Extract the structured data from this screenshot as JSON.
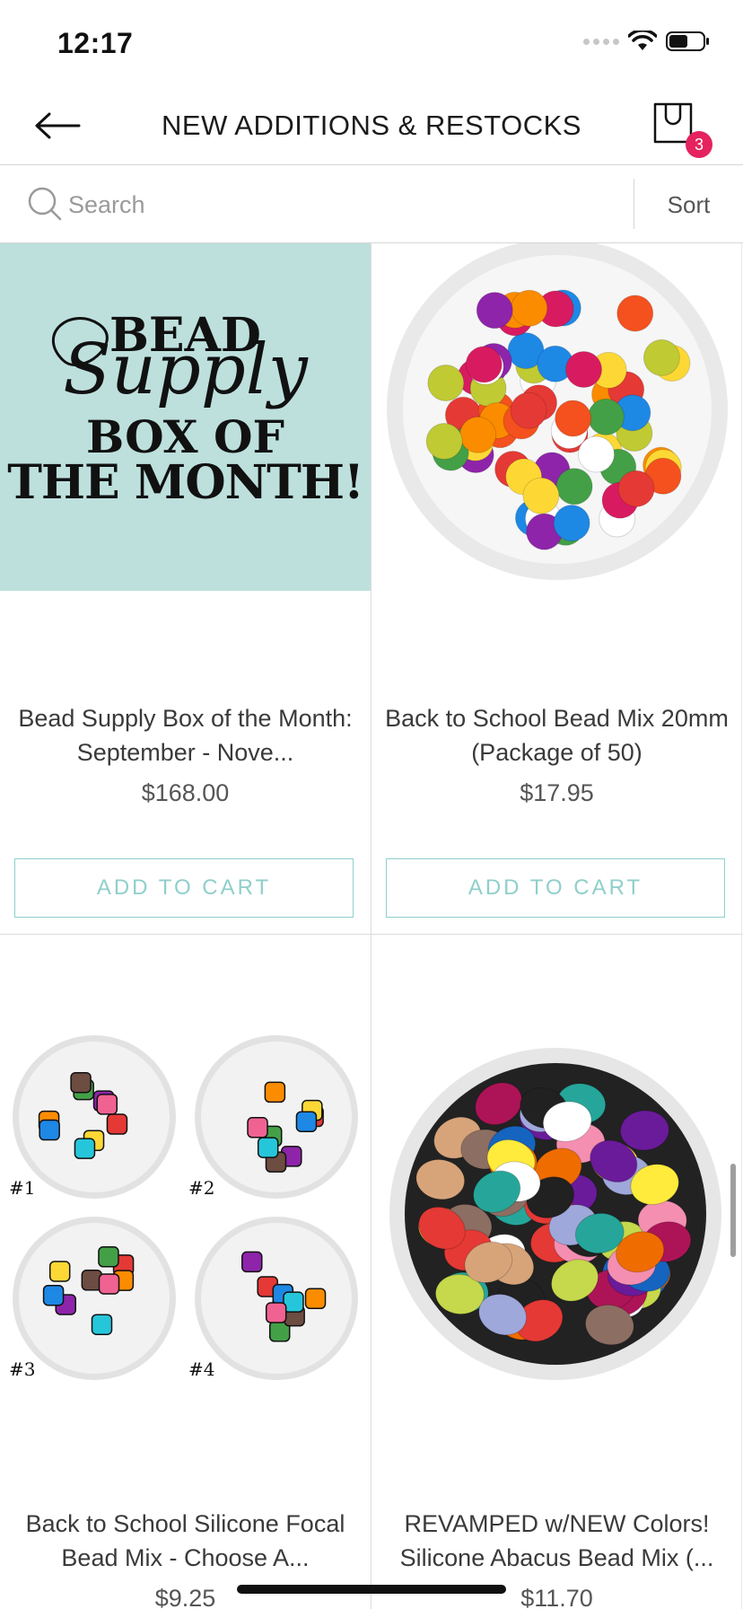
{
  "status_bar": {
    "time": "12:17"
  },
  "header": {
    "title": "NEW ADDITIONS & RESTOCKS",
    "cart_count": "3"
  },
  "search": {
    "placeholder": "Search",
    "sort_label": "Sort"
  },
  "products": [
    {
      "title": "Bead Supply Box of the Month: September - Nove...",
      "price": "$168.00",
      "button": "ADD TO CART",
      "promo": {
        "line1": "BEAD",
        "script": "Supply",
        "line2": "BOX OF",
        "line3": "THE MONTH!"
      }
    },
    {
      "title": "Back to School Bead Mix 20mm (Package of 50)",
      "price": "$17.95",
      "button": "ADD TO CART"
    },
    {
      "title": "Back to School Silicone Focal Bead Mix - Choose A...",
      "price": "$9.25",
      "plate_labels": [
        "#1",
        "#2",
        "#3",
        "#4"
      ]
    },
    {
      "title": "REVAMPED w/NEW Colors! Silicone Abacus Bead Mix (...",
      "price": "$11.70"
    }
  ],
  "colors": {
    "accent": "#8fd0cc",
    "badge": "#e4235f",
    "promo_bg": "#bde0dd"
  }
}
